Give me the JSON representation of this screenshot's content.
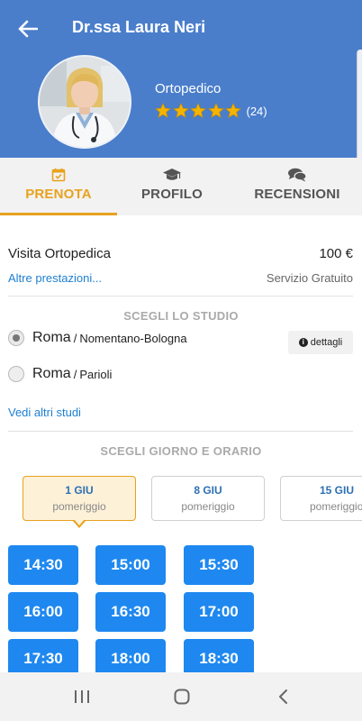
{
  "header": {
    "title": "Dr.ssa Laura Neri",
    "specialty": "Ortopedico",
    "rating_stars": 5,
    "rating_count": "(24)",
    "colors": {
      "header_bg": "#4a7ecb",
      "star": "#f5b400"
    }
  },
  "tabs": [
    {
      "label": "PRENOTA",
      "icon": "calendar-check-icon",
      "active": true
    },
    {
      "label": "PROFILO",
      "icon": "graduation-cap-icon",
      "active": false
    },
    {
      "label": "RECENSIONI",
      "icon": "chat-bubbles-icon",
      "active": false
    }
  ],
  "visit": {
    "name": "Visita Ortopedica",
    "price": "100 €",
    "other_services": "Altre prestazioni...",
    "service_note": "Servizio Gratuito"
  },
  "studio_section": {
    "title": "SCEGLI LO STUDIO",
    "studios": [
      {
        "city": "Roma",
        "sep": "/",
        "area": "Nomentano-Bologna",
        "selected": true
      },
      {
        "city": "Roma",
        "sep": "/",
        "area": "Parioli",
        "selected": false
      }
    ],
    "details_label": "dettagli",
    "more_label": "Vedi altri studi"
  },
  "schedule": {
    "title": "SCEGLI GIORNO E ORARIO",
    "days": [
      {
        "date": "1 GIU",
        "period": "pomeriggio",
        "active": true
      },
      {
        "date": "8 GIU",
        "period": "pomeriggio",
        "active": false
      },
      {
        "date": "15 GIU",
        "period": "pomeriggio",
        "active": false
      }
    ],
    "slots": [
      "14:30",
      "15:00",
      "15:30",
      "16:00",
      "16:30",
      "17:00",
      "17:30",
      "18:00",
      "18:30"
    ],
    "colors": {
      "accent": "#e8a21f",
      "slot": "#1e88f0",
      "link": "#1e7fd0"
    }
  }
}
